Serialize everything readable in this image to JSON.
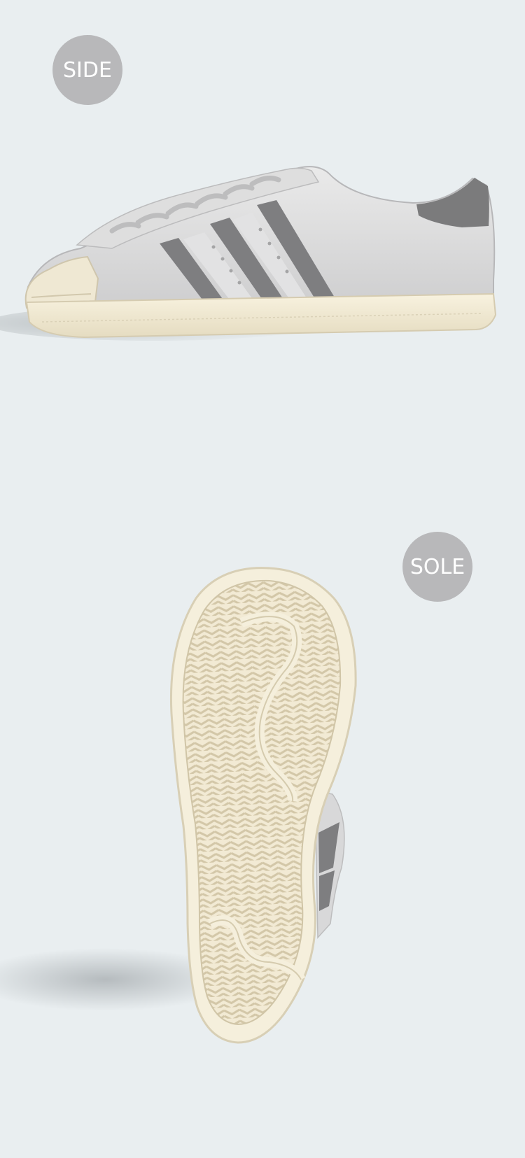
{
  "badges": {
    "side": "SIDE",
    "sole": "SOLE"
  },
  "images": {
    "side_view": "shoe-side-view",
    "sole_view": "shoe-sole-view"
  },
  "colors": {
    "background": "#e9eef0",
    "badge": "#b8b8ba",
    "badge_text": "#ffffff",
    "leather": "#d9d9da",
    "stripe": "#7f7f80",
    "sole": "#f1ead6"
  }
}
